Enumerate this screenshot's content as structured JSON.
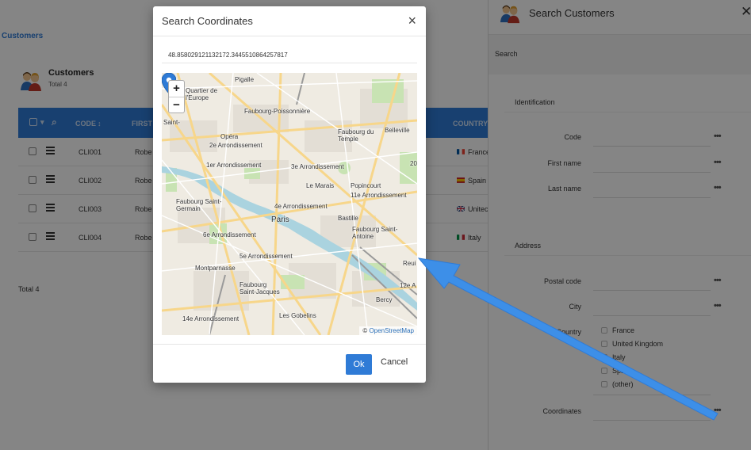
{
  "app": {
    "breadcrumb": "Customers",
    "page_title": "Customers",
    "page_subtitle": "Total 4",
    "grid": {
      "headers": {
        "code": "CODE",
        "first": "FIRST",
        "country": "COUNTRY"
      },
      "rows": [
        {
          "code": "CLI001",
          "first": "Robe",
          "country": "France",
          "flag": "fr"
        },
        {
          "code": "CLI002",
          "first": "Robe",
          "country": "Spain",
          "flag": "es"
        },
        {
          "code": "CLI003",
          "first": "Robe",
          "country": "Unitec",
          "flag": "gb"
        },
        {
          "code": "CLI004",
          "first": "Robe",
          "country": "Italy",
          "flag": "it"
        }
      ],
      "total": "Total 4"
    }
  },
  "side_panel": {
    "title": "Search Customers",
    "search_label": "Search",
    "section_identification": "Identification",
    "code_label": "Code",
    "first_name_label": "First name",
    "last_name_label": "Last name",
    "section_address": "Address",
    "postal_code_label": "Postal code",
    "city_label": "City",
    "country_label": "Country",
    "country_options": [
      "France",
      "United Kingdom",
      "Italy",
      "Spain",
      "(other)"
    ],
    "coordinates_label": "Coordinates",
    "more_glyph": "•••"
  },
  "modal": {
    "title": "Search Coordinates",
    "close_glyph": "×",
    "coordinates_value": "48.858029121132172.3445510864257817",
    "zoom_in": "+",
    "zoom_out": "−",
    "attribution_prefix": "©",
    "attribution_link": "OpenStreetMap",
    "map_labels": [
      "Pigalle",
      "Quartier de l'Europe",
      "Faubourg-Poissonnière",
      "Saint-",
      "Opéra",
      "Faubourg du Temple",
      "Belleville",
      "2e Arrondissement",
      "1er Arrondissement",
      "3e Arrondissement",
      "Le Marais",
      "Popincourt",
      "11e Arrondissement",
      "Faubourg Saint-Germain",
      "4e Arrondissement",
      "Paris",
      "Bastille",
      "6e Arrondissement",
      "Faubourg Saint-Antoine",
      "5e Arrondissement",
      "Montparnasse",
      "Faubourg Saint-Jacques",
      "12e A",
      "Bercy",
      "14e Arrondissement",
      "Les Gobelins",
      "Reui",
      "20"
    ],
    "ok_label": "Ok",
    "cancel_label": "Cancel"
  },
  "colors": {
    "accent": "#2f7bd6",
    "overlay": "rgba(0,0,0,0.48)",
    "arrow": "#3d8fe8"
  }
}
